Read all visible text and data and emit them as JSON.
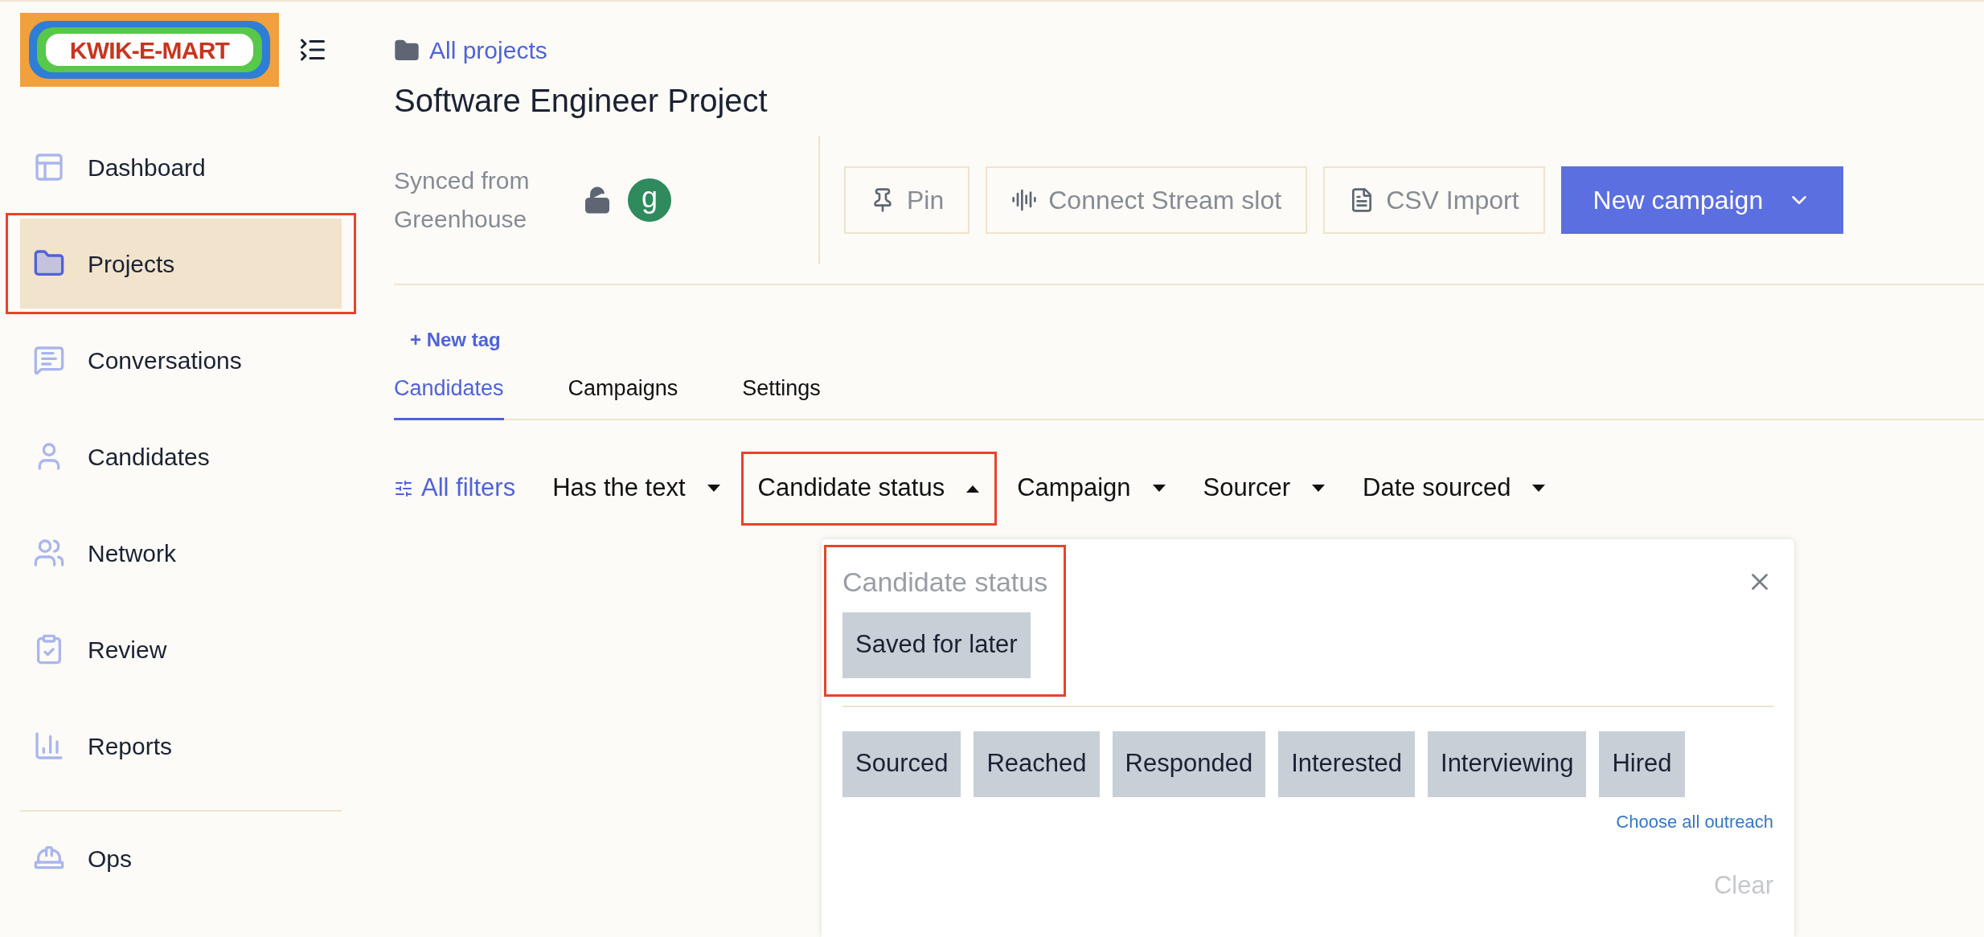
{
  "sidebar": {
    "logo": "KWIK-E-MART",
    "items": [
      {
        "label": "Dashboard",
        "selected": false,
        "highlighted": false
      },
      {
        "label": "Projects",
        "selected": true,
        "highlighted": true
      },
      {
        "label": "Conversations",
        "selected": false,
        "highlighted": false
      },
      {
        "label": "Candidates",
        "selected": false,
        "highlighted": false
      },
      {
        "label": "Network",
        "selected": false,
        "highlighted": false
      },
      {
        "label": "Review",
        "selected": false,
        "highlighted": false
      },
      {
        "label": "Reports",
        "selected": false,
        "highlighted": false
      }
    ],
    "footer_items": [
      {
        "label": "Ops",
        "selected": false
      }
    ]
  },
  "breadcrumb": "All projects",
  "title": "Software Engineer Project",
  "sync": {
    "text": "Synced from Greenhouse",
    "badge": "g"
  },
  "actions": [
    {
      "label": "Pin",
      "kind": "outline"
    },
    {
      "label": "Connect Stream slot",
      "kind": "outline"
    },
    {
      "label": "CSV Import",
      "kind": "outline"
    },
    {
      "label": "New campaign",
      "kind": "primary"
    }
  ],
  "new_tag": "+ New tag",
  "tabs": [
    {
      "label": "Candidates",
      "selected": true
    },
    {
      "label": "Campaigns",
      "selected": false
    },
    {
      "label": "Settings",
      "selected": false
    }
  ],
  "all_filters": "All filters",
  "filters": [
    {
      "label": "Has the text",
      "expanded": false,
      "highlighted": false
    },
    {
      "label": "Candidate status",
      "expanded": true,
      "highlighted": true
    },
    {
      "label": "Campaign",
      "expanded": false,
      "highlighted": false
    },
    {
      "label": "Sourcer",
      "expanded": false,
      "highlighted": false
    },
    {
      "label": "Date sourced",
      "expanded": false,
      "highlighted": false
    }
  ],
  "popup": {
    "title": "Candidate status",
    "highlighted": true,
    "selected_chips": [
      "Saved for later"
    ],
    "options": [
      "Sourced",
      "Reached",
      "Responded",
      "Interested",
      "Interviewing",
      "Hired"
    ],
    "choose_all": "Choose all outreach",
    "clear": "Clear"
  }
}
